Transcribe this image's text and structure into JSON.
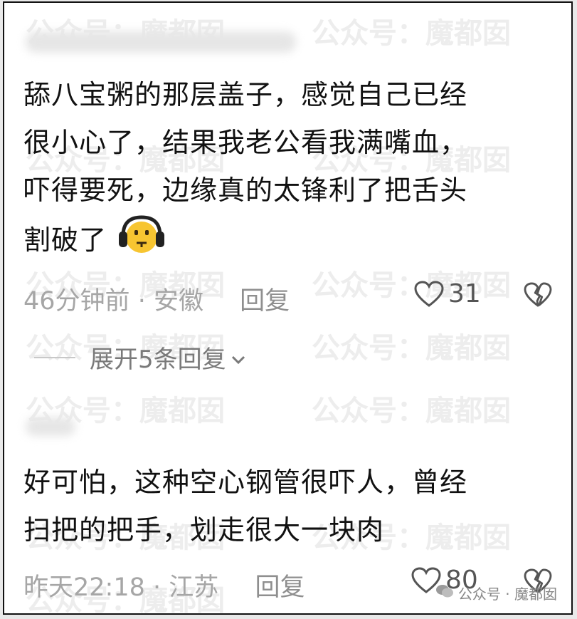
{
  "watermark": {
    "text": "公众号：魔都囡"
  },
  "comments": [
    {
      "text_lines": [
        "舔八宝粥的那层盖子，感觉自己已经",
        "很小心了，结果我老公看我满嘴血，",
        "吓得要死，边缘真的太锋利了把舌头",
        "割破了"
      ],
      "time": "46分钟前",
      "location": "安徽",
      "reply_label": "回复",
      "likes": "31",
      "expand_replies": "展开5条回复"
    },
    {
      "text_lines": [
        "好可怕，这种空心钢管很吓人，曾经",
        "扫把的把手，划走很大一块肉"
      ],
      "time": "昨天22:18",
      "location": "江苏",
      "reply_label": "回复",
      "likes": "80"
    }
  ],
  "separator": "·",
  "brand": {
    "label": "公众号 · 魔都囡"
  }
}
